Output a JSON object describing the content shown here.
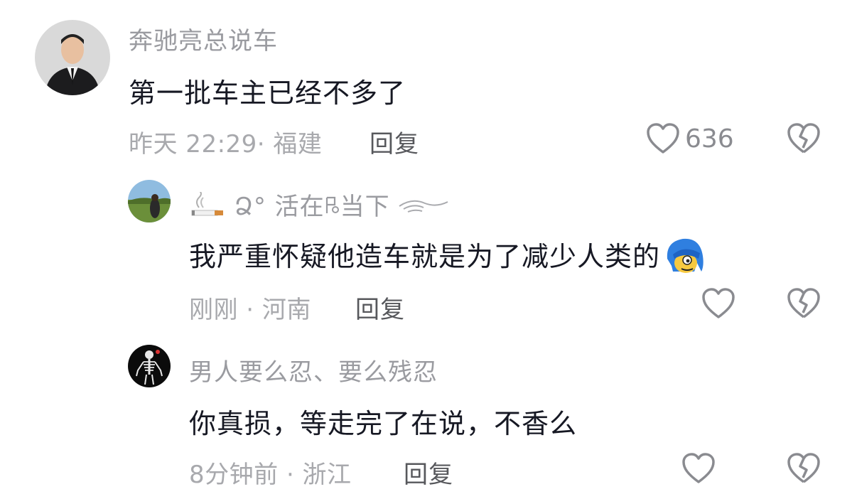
{
  "comments": [
    {
      "username": "奔驰亮总说车",
      "content": "第一批车主已经不多了",
      "meta": "昨天 22:29· 福建",
      "reply_label": "回复",
      "like_count": "636",
      "avatar": "man-in-suit-avatar"
    },
    {
      "username_text": "活在",
      "username_text2": "当下",
      "username_prefix_deco": "Ձ°",
      "content": "我严重怀疑他造车就是为了减少人类的",
      "meta": "刚刚 · 河南",
      "reply_label": "回复",
      "avatar": "grassland-avatar",
      "emoji": "blue-hair-emoji"
    },
    {
      "username": "男人要么忍、要么残忍",
      "content": "你真损，等走完了在说，不香么",
      "meta": "8分钟前 · 浙江",
      "reply_label": "回复",
      "avatar": "skeleton-avatar"
    }
  ],
  "colors": {
    "username": "#9a9ba0",
    "content": "#161823",
    "meta": "#a8a9ad",
    "reply": "#57585c",
    "icon": "#8a8b90"
  }
}
